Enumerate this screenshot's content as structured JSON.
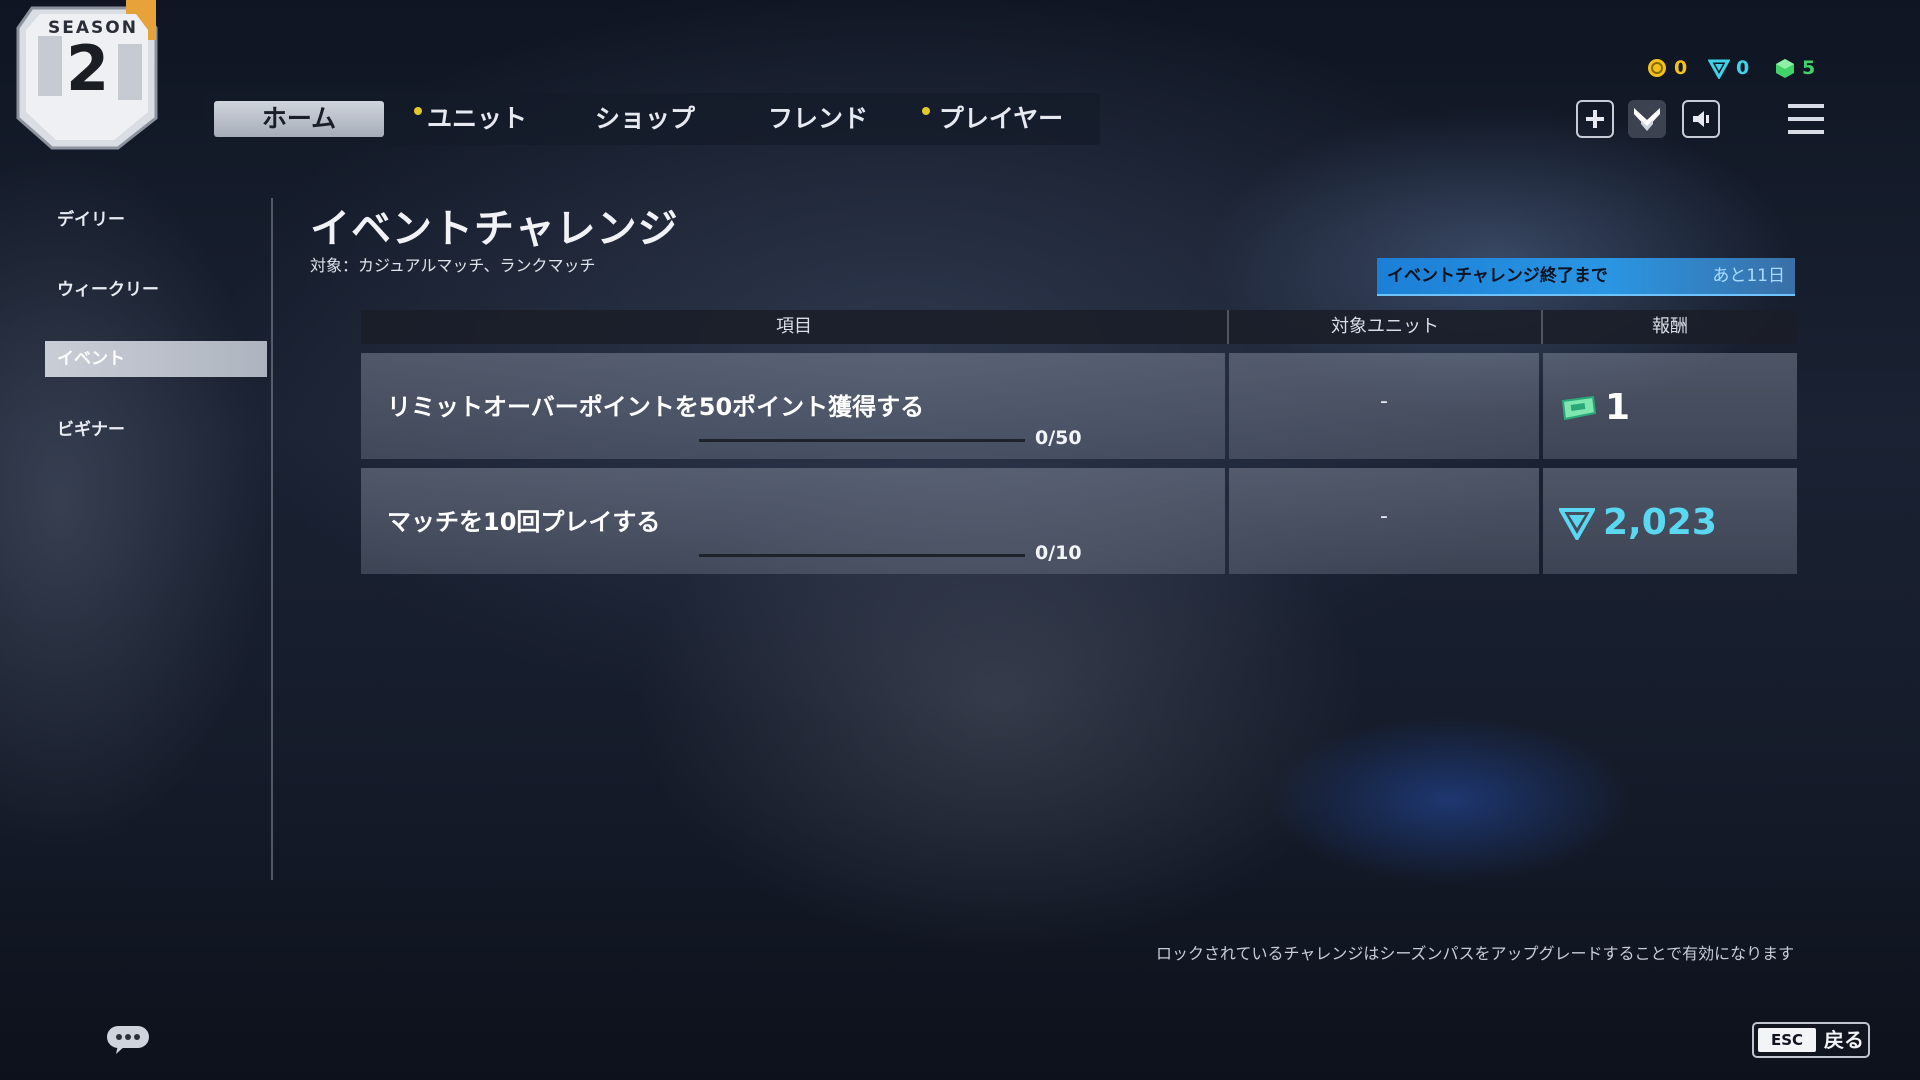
{
  "season": {
    "label": "SEASON",
    "number": "2"
  },
  "nav": {
    "tabs": [
      {
        "label": "ホーム",
        "active": true,
        "dot": false
      },
      {
        "label": "ユニット",
        "active": false,
        "dot": true
      },
      {
        "label": "ショップ",
        "active": false,
        "dot": false
      },
      {
        "label": "フレンド",
        "active": false,
        "dot": false
      },
      {
        "label": "プレイヤー",
        "active": false,
        "dot": true
      }
    ]
  },
  "currencies": {
    "gold": {
      "icon": "coin-icon",
      "value": "0",
      "color": "#f2c21b"
    },
    "crystal": {
      "icon": "crystal-icon",
      "value": "0",
      "color": "#3fd2e8"
    },
    "cube": {
      "icon": "cube-icon",
      "value": "5",
      "color": "#41d36a"
    }
  },
  "sidebar": {
    "items": [
      {
        "label": "デイリー",
        "active": false
      },
      {
        "label": "ウィークリー",
        "active": false
      },
      {
        "label": "イベント",
        "active": true
      },
      {
        "label": "ビギナー",
        "active": false
      }
    ]
  },
  "page": {
    "title": "イベントチャレンジ",
    "subtitle": "対象：カジュアルマッチ、ランクマッチ"
  },
  "timer": {
    "label": "イベントチャレンジ終了まで",
    "remaining": "あと11日"
  },
  "table": {
    "headers": [
      "項目",
      "対象ユニット",
      "報酬"
    ],
    "rows": [
      {
        "task": "リミットオーバーポイントを50ポイント獲得する",
        "progress_text": "0/50",
        "progress": 0,
        "unit": "-",
        "reward_icon": "ticket-icon",
        "reward_value": "1",
        "reward_color": "#ffffff"
      },
      {
        "task": "マッチを10回プレイする",
        "progress_text": "0/10",
        "progress": 0,
        "unit": "-",
        "reward_icon": "crystal-icon",
        "reward_value": "2,023",
        "reward_color": "#5ad8f2"
      }
    ]
  },
  "footer": {
    "note": "ロックされているチャレンジはシーズンパスをアップグレードすることで有効になります",
    "esc_key": "ESC",
    "back_label": "戻る"
  },
  "colors": {
    "accent_blue": "#2a96e3",
    "nav_dot": "#e3c92a"
  }
}
